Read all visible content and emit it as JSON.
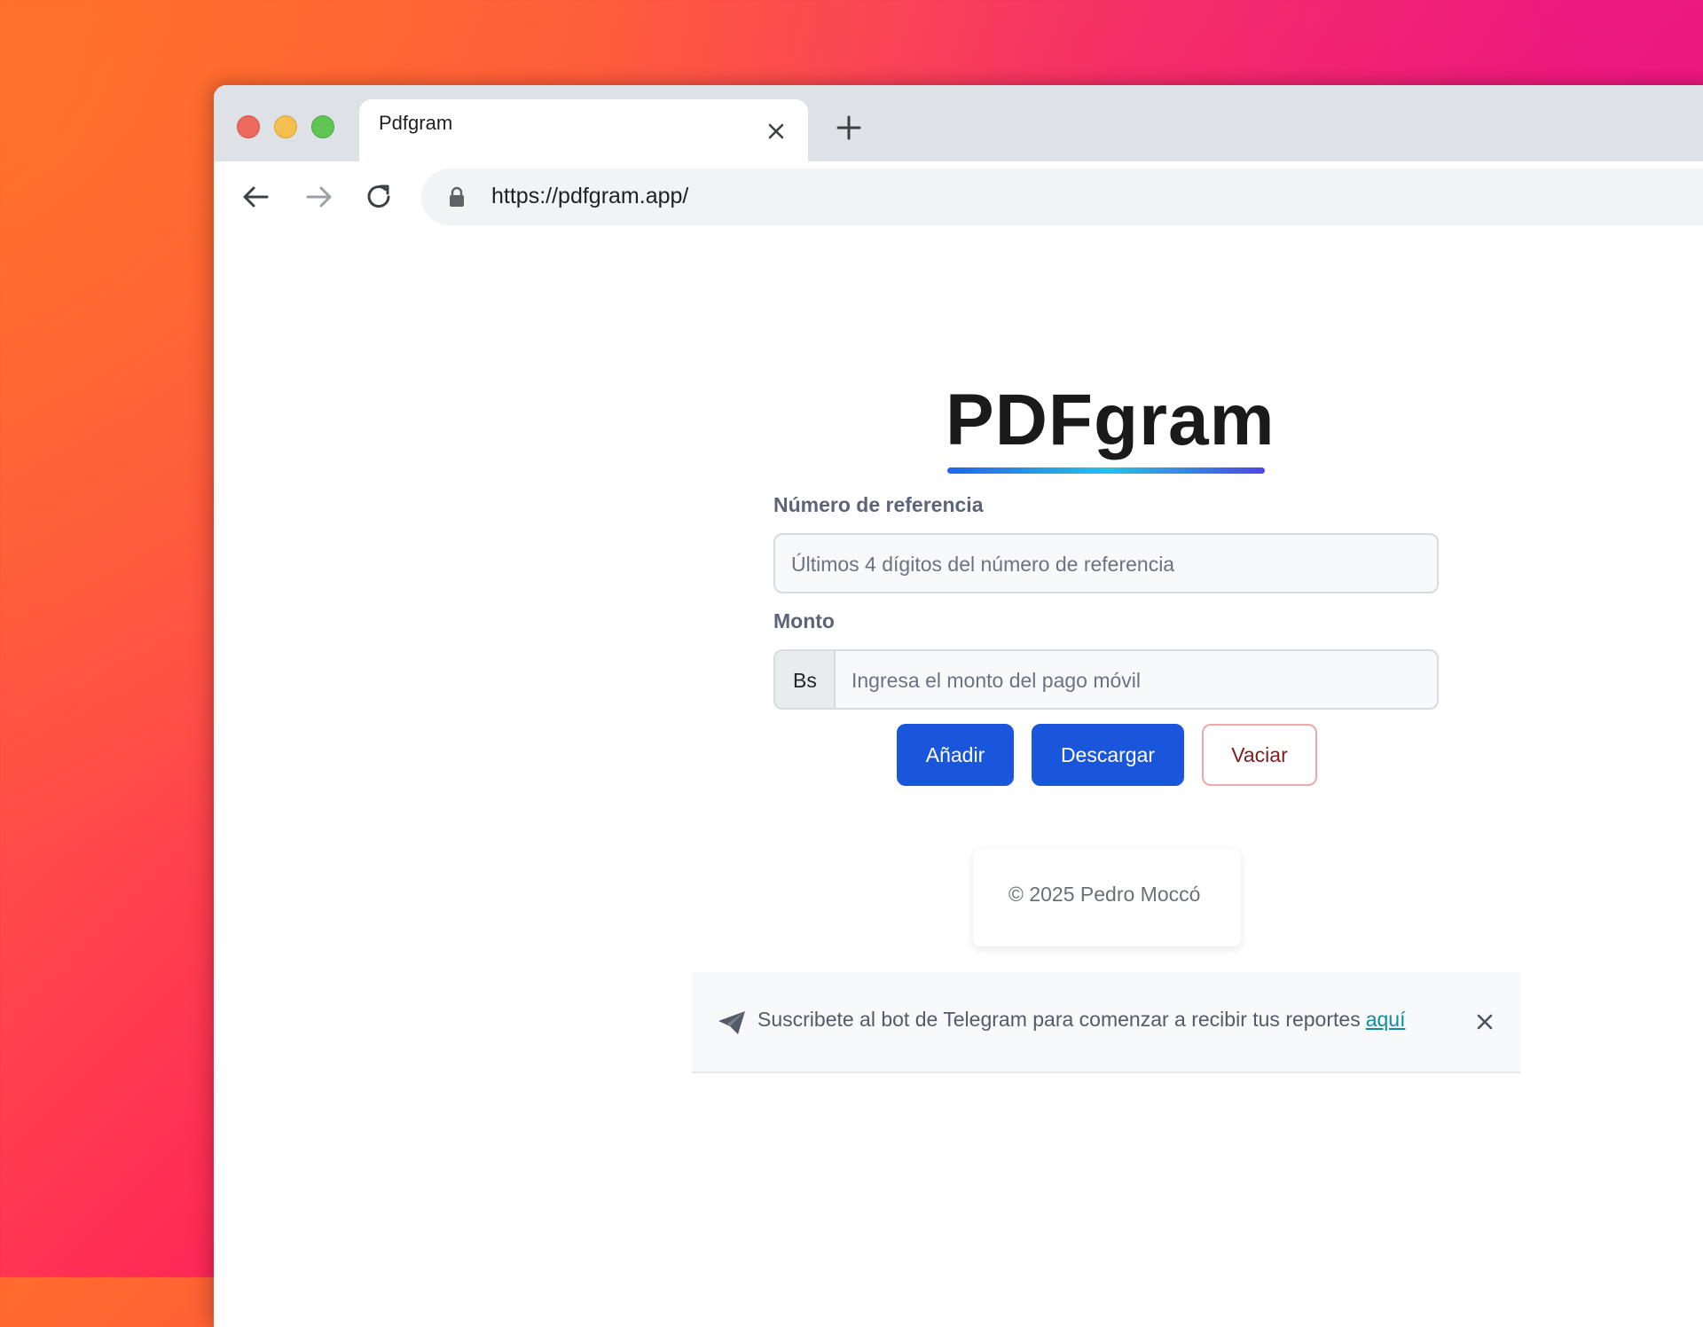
{
  "browser": {
    "tab_title": "Pdfgram",
    "url": "https://pdfgram.app/"
  },
  "page": {
    "logo_text": "PDFgram",
    "reference_label": "Número de referencia",
    "reference_placeholder": "Últimos 4 dígitos del número de referencia",
    "amount_label": "Monto",
    "currency_addon": "Bs",
    "amount_placeholder": "Ingresa el monto del pago móvil",
    "buttons": {
      "add": "Añadir",
      "download": "Descargar",
      "clear": "Vaciar"
    },
    "footer_text": "© 2025 Pedro Moccó",
    "toast": {
      "message": "Suscribete al bot de Telegram para comenzar a recibir tus reportes",
      "link_text": "aquí"
    }
  },
  "colors": {
    "primary_button": "#1a56db",
    "danger_outline": "#f2a7ae",
    "link": "#0e8ea1"
  },
  "icons": [
    "close-icon",
    "plus-icon",
    "arrow-left-icon",
    "arrow-right-icon",
    "reload-icon",
    "lock-icon",
    "telegram-send-icon"
  ]
}
